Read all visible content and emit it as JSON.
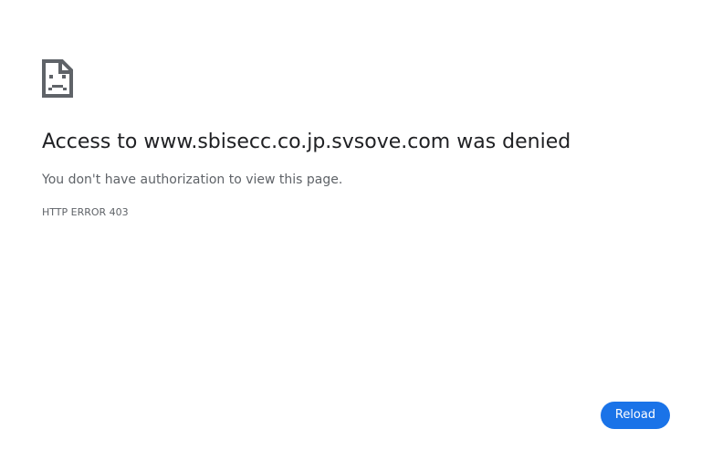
{
  "icon": "sad-page-icon",
  "title": "Access to www.sbisecc.co.jp.svsove.com was denied",
  "message": "You don't have authorization to view this page.",
  "error_code": "HTTP ERROR 403",
  "reload_label": "Reload",
  "colors": {
    "accent": "#1a73e8",
    "text_primary": "#202124",
    "text_secondary": "#5f6368",
    "background": "#ffffff"
  }
}
